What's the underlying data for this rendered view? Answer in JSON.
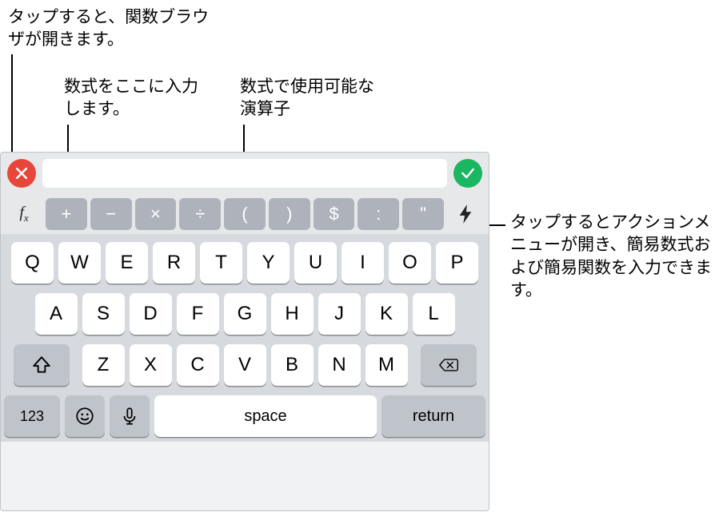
{
  "callouts": {
    "fx": "タップすると、関数ブラウザが開きます。",
    "formula": "数式をここに入力します。",
    "operators": "数式で使用可能な演算子",
    "bolt": "タップするとアクションメニューが開き、簡易数式および簡易関数を入力できます。"
  },
  "formula_bar": {
    "value": "",
    "placeholder": ""
  },
  "operator_keys": [
    "+",
    "−",
    "×",
    "÷",
    "(",
    ")",
    "$",
    ":",
    "\""
  ],
  "keyboard": {
    "row1": [
      "Q",
      "W",
      "E",
      "R",
      "T",
      "Y",
      "U",
      "I",
      "O",
      "P"
    ],
    "row2": [
      "A",
      "S",
      "D",
      "F",
      "G",
      "H",
      "J",
      "K",
      "L"
    ],
    "row3": [
      "Z",
      "X",
      "C",
      "V",
      "B",
      "N",
      "M"
    ],
    "mode_label": "123",
    "space_label": "space",
    "return_label": "return"
  },
  "icons": {
    "fx": "fx",
    "cancel": "cancel",
    "confirm": "confirm",
    "bolt": "bolt",
    "shift": "shift",
    "backspace": "backspace",
    "emoji": "emoji",
    "mic": "mic"
  }
}
